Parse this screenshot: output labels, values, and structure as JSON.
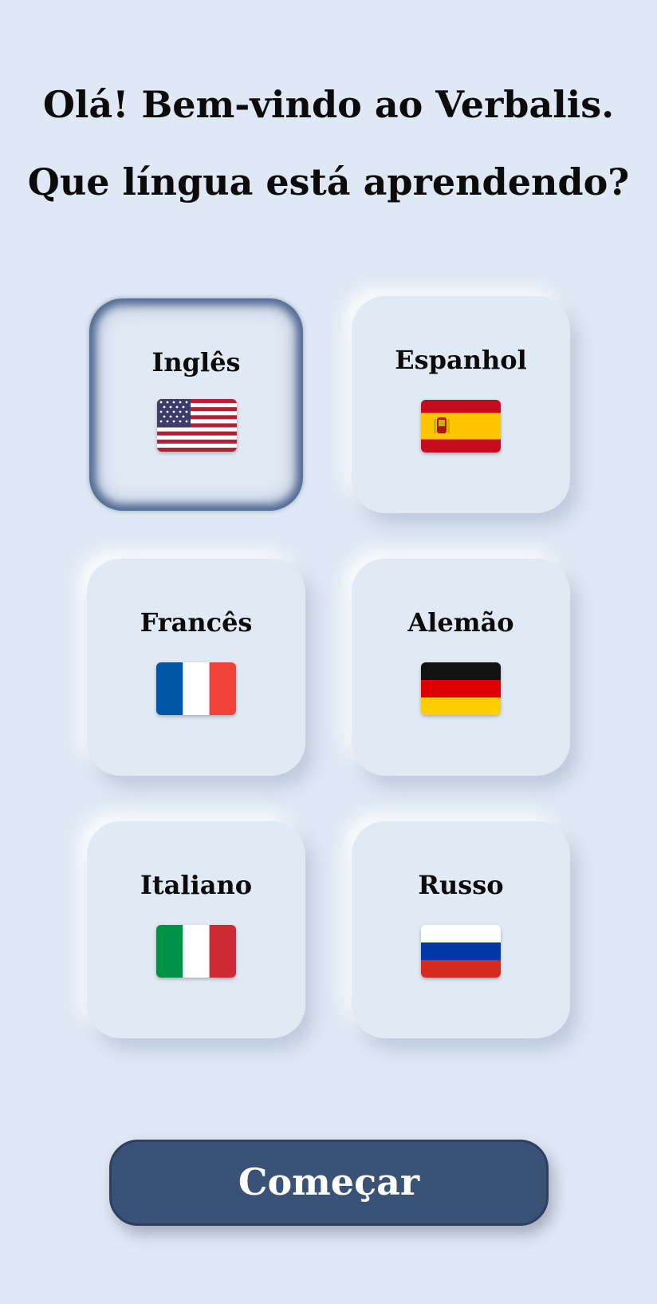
{
  "header": {
    "greeting": "Olá! Bem-vindo ao Verbalis.",
    "question": "Que língua está aprendendo?"
  },
  "languages": [
    {
      "label": "Inglês",
      "flag_icon": "us-flag-icon",
      "selected": true
    },
    {
      "label": "Espanhol",
      "flag_icon": "spain-flag-icon",
      "selected": false
    },
    {
      "label": "Francês",
      "flag_icon": "france-flag-icon",
      "selected": false
    },
    {
      "label": "Alemão",
      "flag_icon": "germany-flag-icon",
      "selected": false
    },
    {
      "label": "Italiano",
      "flag_icon": "italy-flag-icon",
      "selected": false
    },
    {
      "label": "Russo",
      "flag_icon": "russia-flag-icon",
      "selected": false
    }
  ],
  "start_button": {
    "label": "Começar"
  },
  "colors": {
    "background": "#dfe8f4",
    "accent": "#3a5275",
    "selected_border": "#425c87"
  }
}
